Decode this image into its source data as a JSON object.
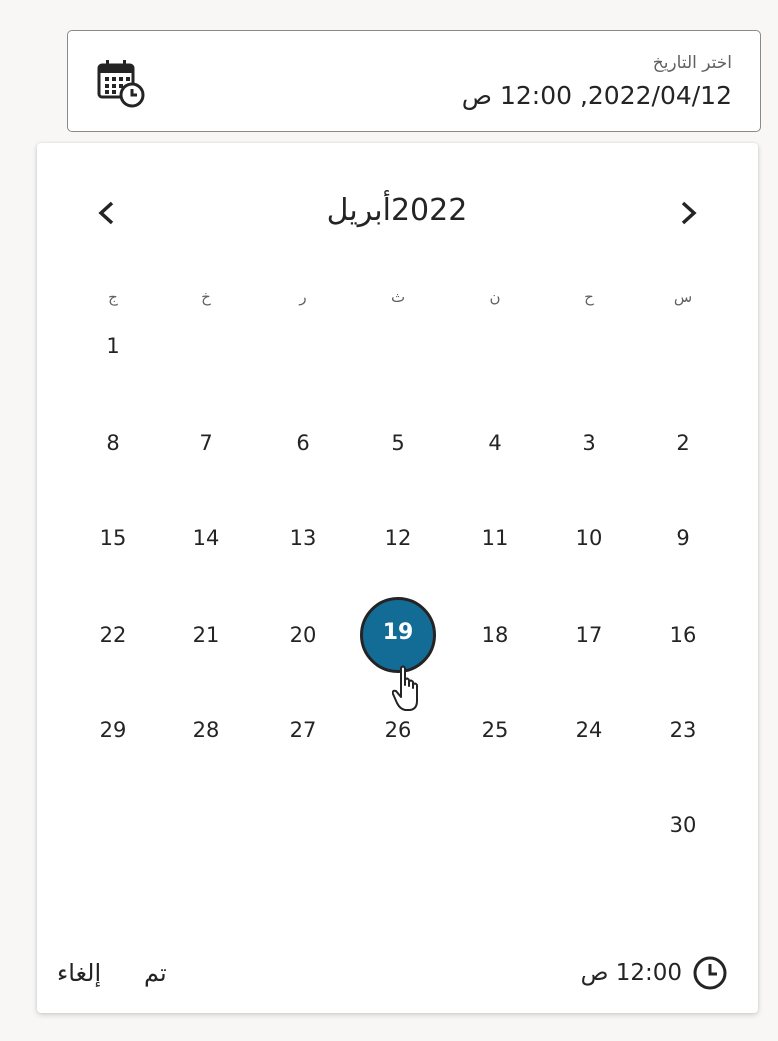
{
  "field": {
    "label": "اختر التاريخ",
    "value": "2022/04/12, 12:00 ص",
    "icon": "calendar-clock-icon"
  },
  "calendar": {
    "month_name": "أبريل",
    "year": "2022",
    "prev_icon": "chevron-left-icon",
    "next_icon": "chevron-right-icon",
    "weekdays": [
      "س",
      "ح",
      "ن",
      "ث",
      "ر",
      "خ",
      "ج"
    ],
    "weeks": [
      [
        "",
        "",
        "",
        "",
        "",
        "",
        "1"
      ],
      [
        "2",
        "3",
        "4",
        "5",
        "6",
        "7",
        "8"
      ],
      [
        "9",
        "10",
        "11",
        "12",
        "13",
        "14",
        "15"
      ],
      [
        "16",
        "17",
        "18",
        "19",
        "20",
        "21",
        "22"
      ],
      [
        "23",
        "24",
        "25",
        "26",
        "27",
        "28",
        "29"
      ],
      [
        "30",
        "",
        "",
        "",
        "",
        "",
        ""
      ]
    ],
    "selected_day": "19",
    "selected_color": "#136c96"
  },
  "footer": {
    "time": "12:00 ص",
    "time_icon": "clock-icon",
    "done_label": "تم",
    "cancel_label": "إلغاء"
  }
}
